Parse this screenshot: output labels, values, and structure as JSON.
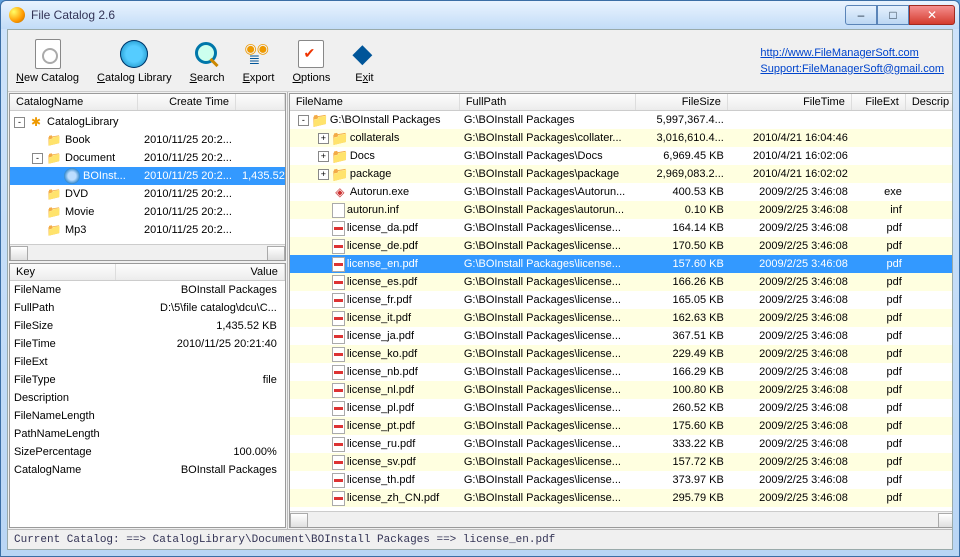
{
  "title": "File Catalog  2.6",
  "toolbar": {
    "new_catalog": "New Catalog",
    "catalog_library": "Catalog Library",
    "search": "Search",
    "export": "Export",
    "options": "Options",
    "exit": "Exit"
  },
  "links": {
    "homepage": "http://www.FileManagerSoft.com",
    "support": "Support:FileManagerSoft@gmail.com"
  },
  "tree_headers": [
    "CatalogName",
    "Create Time",
    ""
  ],
  "tree": [
    {
      "depth": 0,
      "exp": "-",
      "icon": "root",
      "name": "CatalogLibrary",
      "time": "",
      "size": "",
      "sel": false
    },
    {
      "depth": 1,
      "exp": "",
      "icon": "folder",
      "name": "Book",
      "time": "2010/11/25 20:2...",
      "size": "",
      "sel": false
    },
    {
      "depth": 1,
      "exp": "-",
      "icon": "folder",
      "name": "Document",
      "time": "2010/11/25 20:2...",
      "size": "",
      "sel": false
    },
    {
      "depth": 2,
      "exp": "",
      "icon": "disc",
      "name": "BOInst...",
      "time": "2010/11/25 20:2...",
      "size": "1,435.52",
      "sel": true
    },
    {
      "depth": 1,
      "exp": "",
      "icon": "folder",
      "name": "DVD",
      "time": "2010/11/25 20:2...",
      "size": "",
      "sel": false
    },
    {
      "depth": 1,
      "exp": "",
      "icon": "folder",
      "name": "Movie",
      "time": "2010/11/25 20:2...",
      "size": "",
      "sel": false
    },
    {
      "depth": 1,
      "exp": "",
      "icon": "folder",
      "name": "Mp3",
      "time": "2010/11/25 20:2...",
      "size": "",
      "sel": false
    }
  ],
  "prop_headers": [
    "Key",
    "Value"
  ],
  "props": [
    {
      "k": "FileName",
      "v": "BOInstall Packages"
    },
    {
      "k": "FullPath",
      "v": "D:\\5\\file catalog\\dcu\\C..."
    },
    {
      "k": "FileSize",
      "v": "1,435.52 KB"
    },
    {
      "k": "FileTime",
      "v": "2010/11/25 20:21:40"
    },
    {
      "k": "FileExt",
      "v": ""
    },
    {
      "k": "FileType",
      "v": "file"
    },
    {
      "k": "Description",
      "v": ""
    },
    {
      "k": "FileNameLength",
      "v": ""
    },
    {
      "k": "PathNameLength",
      "v": ""
    },
    {
      "k": "SizePercentage",
      "v": "100.00%"
    },
    {
      "k": "CatalogName",
      "v": "BOInstall Packages"
    }
  ],
  "file_headers": [
    "FileName",
    "FullPath",
    "FileSize",
    "FileTime",
    "FileExt",
    "Descrip"
  ],
  "files": [
    {
      "depth": 0,
      "exp": "-",
      "icon": "folder",
      "name": "G:\\BOInstall Packages",
      "path": "G:\\BOInstall Packages",
      "size": "5,997,367.4...",
      "time": "",
      "ext": "",
      "sel": false,
      "alt": false
    },
    {
      "depth": 1,
      "exp": "+",
      "icon": "folder",
      "name": "collaterals",
      "path": "G:\\BOInstall Packages\\collater...",
      "size": "3,016,610.4...",
      "time": "2010/4/21 16:04:46",
      "ext": "",
      "sel": false,
      "alt": true
    },
    {
      "depth": 1,
      "exp": "+",
      "icon": "folder",
      "name": "Docs",
      "path": "G:\\BOInstall Packages\\Docs",
      "size": "6,969.45 KB",
      "time": "2010/4/21 16:02:06",
      "ext": "",
      "sel": false,
      "alt": false
    },
    {
      "depth": 1,
      "exp": "+",
      "icon": "folder",
      "name": "package",
      "path": "G:\\BOInstall Packages\\package",
      "size": "2,969,083.2...",
      "time": "2010/4/21 16:02:02",
      "ext": "",
      "sel": false,
      "alt": true
    },
    {
      "depth": 1,
      "exp": "",
      "icon": "exe",
      "name": "Autorun.exe",
      "path": "G:\\BOInstall Packages\\Autorun...",
      "size": "400.53 KB",
      "time": "2009/2/25 3:46:08",
      "ext": "exe",
      "sel": false,
      "alt": false
    },
    {
      "depth": 1,
      "exp": "",
      "icon": "inf",
      "name": "autorun.inf",
      "path": "G:\\BOInstall Packages\\autorun...",
      "size": "0.10 KB",
      "time": "2009/2/25 3:46:08",
      "ext": "inf",
      "sel": false,
      "alt": true
    },
    {
      "depth": 1,
      "exp": "",
      "icon": "pdf",
      "name": "license_da.pdf",
      "path": "G:\\BOInstall Packages\\license...",
      "size": "164.14 KB",
      "time": "2009/2/25 3:46:08",
      "ext": "pdf",
      "sel": false,
      "alt": false
    },
    {
      "depth": 1,
      "exp": "",
      "icon": "pdf",
      "name": "license_de.pdf",
      "path": "G:\\BOInstall Packages\\license...",
      "size": "170.50 KB",
      "time": "2009/2/25 3:46:08",
      "ext": "pdf",
      "sel": false,
      "alt": true
    },
    {
      "depth": 1,
      "exp": "",
      "icon": "pdf",
      "name": "license_en.pdf",
      "path": "G:\\BOInstall Packages\\license...",
      "size": "157.60 KB",
      "time": "2009/2/25 3:46:08",
      "ext": "pdf",
      "sel": true,
      "alt": false
    },
    {
      "depth": 1,
      "exp": "",
      "icon": "pdf",
      "name": "license_es.pdf",
      "path": "G:\\BOInstall Packages\\license...",
      "size": "166.26 KB",
      "time": "2009/2/25 3:46:08",
      "ext": "pdf",
      "sel": false,
      "alt": true
    },
    {
      "depth": 1,
      "exp": "",
      "icon": "pdf",
      "name": "license_fr.pdf",
      "path": "G:\\BOInstall Packages\\license...",
      "size": "165.05 KB",
      "time": "2009/2/25 3:46:08",
      "ext": "pdf",
      "sel": false,
      "alt": false
    },
    {
      "depth": 1,
      "exp": "",
      "icon": "pdf",
      "name": "license_it.pdf",
      "path": "G:\\BOInstall Packages\\license...",
      "size": "162.63 KB",
      "time": "2009/2/25 3:46:08",
      "ext": "pdf",
      "sel": false,
      "alt": true
    },
    {
      "depth": 1,
      "exp": "",
      "icon": "pdf",
      "name": "license_ja.pdf",
      "path": "G:\\BOInstall Packages\\license...",
      "size": "367.51 KB",
      "time": "2009/2/25 3:46:08",
      "ext": "pdf",
      "sel": false,
      "alt": false
    },
    {
      "depth": 1,
      "exp": "",
      "icon": "pdf",
      "name": "license_ko.pdf",
      "path": "G:\\BOInstall Packages\\license...",
      "size": "229.49 KB",
      "time": "2009/2/25 3:46:08",
      "ext": "pdf",
      "sel": false,
      "alt": true
    },
    {
      "depth": 1,
      "exp": "",
      "icon": "pdf",
      "name": "license_nb.pdf",
      "path": "G:\\BOInstall Packages\\license...",
      "size": "166.29 KB",
      "time": "2009/2/25 3:46:08",
      "ext": "pdf",
      "sel": false,
      "alt": false
    },
    {
      "depth": 1,
      "exp": "",
      "icon": "pdf",
      "name": "license_nl.pdf",
      "path": "G:\\BOInstall Packages\\license...",
      "size": "100.80 KB",
      "time": "2009/2/25 3:46:08",
      "ext": "pdf",
      "sel": false,
      "alt": true
    },
    {
      "depth": 1,
      "exp": "",
      "icon": "pdf",
      "name": "license_pl.pdf",
      "path": "G:\\BOInstall Packages\\license...",
      "size": "260.52 KB",
      "time": "2009/2/25 3:46:08",
      "ext": "pdf",
      "sel": false,
      "alt": false
    },
    {
      "depth": 1,
      "exp": "",
      "icon": "pdf",
      "name": "license_pt.pdf",
      "path": "G:\\BOInstall Packages\\license...",
      "size": "175.60 KB",
      "time": "2009/2/25 3:46:08",
      "ext": "pdf",
      "sel": false,
      "alt": true
    },
    {
      "depth": 1,
      "exp": "",
      "icon": "pdf",
      "name": "license_ru.pdf",
      "path": "G:\\BOInstall Packages\\license...",
      "size": "333.22 KB",
      "time": "2009/2/25 3:46:08",
      "ext": "pdf",
      "sel": false,
      "alt": false
    },
    {
      "depth": 1,
      "exp": "",
      "icon": "pdf",
      "name": "license_sv.pdf",
      "path": "G:\\BOInstall Packages\\license...",
      "size": "157.72 KB",
      "time": "2009/2/25 3:46:08",
      "ext": "pdf",
      "sel": false,
      "alt": true
    },
    {
      "depth": 1,
      "exp": "",
      "icon": "pdf",
      "name": "license_th.pdf",
      "path": "G:\\BOInstall Packages\\license...",
      "size": "373.97 KB",
      "time": "2009/2/25 3:46:08",
      "ext": "pdf",
      "sel": false,
      "alt": false
    },
    {
      "depth": 1,
      "exp": "",
      "icon": "pdf",
      "name": "license_zh_CN.pdf",
      "path": "G:\\BOInstall Packages\\license...",
      "size": "295.79 KB",
      "time": "2009/2/25 3:46:08",
      "ext": "pdf",
      "sel": false,
      "alt": true
    }
  ],
  "status": "Current Catalog: ==> CatalogLibrary\\Document\\BOInstall Packages ==> license_en.pdf"
}
